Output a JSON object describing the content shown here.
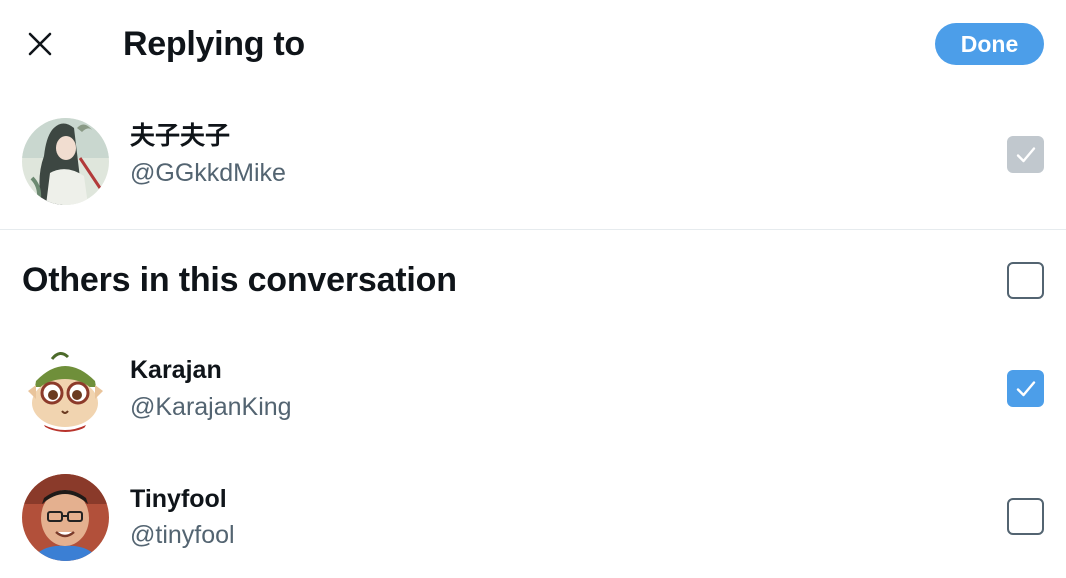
{
  "header": {
    "title": "Replying to",
    "done_label": "Done"
  },
  "primary_user": {
    "name": "夫子夫子",
    "handle": "@GGkkdMike",
    "checked": true,
    "disabled": true
  },
  "others": {
    "title": "Others in this conversation",
    "all_checked": false,
    "users": [
      {
        "name": "Karajan",
        "handle": "@KarajanKing",
        "checked": true
      },
      {
        "name": "Tinyfool",
        "handle": "@tinyfool",
        "checked": false
      }
    ]
  },
  "colors": {
    "accent": "#4c9ee9",
    "disabled_check": "#c1c8ce",
    "secondary_text": "#536471",
    "primary_text": "#0f1419",
    "divider": "#e6ebee"
  }
}
